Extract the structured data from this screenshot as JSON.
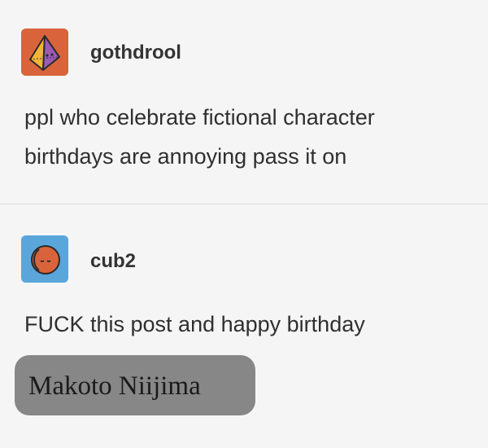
{
  "posts": [
    {
      "username": "gothdrool",
      "avatar_icon": "pyramid-icon",
      "avatar_color": "#d9643c",
      "lines": [
        "ppl who celebrate fictional character",
        "birthdays are annoying pass it on"
      ]
    },
    {
      "username": "cub2",
      "avatar_icon": "sleeping-face-icon",
      "avatar_color": "#5aa6db",
      "lines": [
        "FUCK this post and happy birthday"
      ]
    }
  ],
  "caption": {
    "text": "Makoto Niijima"
  }
}
